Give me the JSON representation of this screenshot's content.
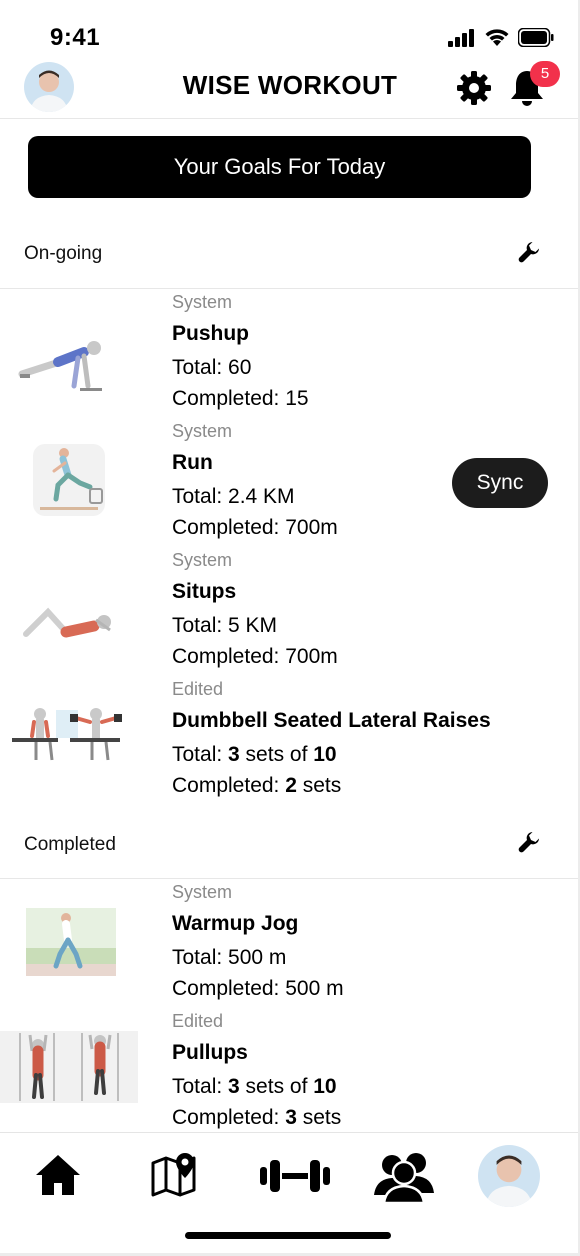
{
  "status_bar": {
    "time": "9:41"
  },
  "header": {
    "title": "WISE WORKOUT",
    "notification_count": "5"
  },
  "goals_button": {
    "label": "Your Goals For Today"
  },
  "sections": {
    "ongoing": {
      "label": "On-going"
    },
    "completed": {
      "label": "Completed"
    }
  },
  "ongoing_items": [
    {
      "source": "System",
      "name": "Pushup",
      "total": "Total: 60",
      "completed": "Completed: 15"
    },
    {
      "source": "System",
      "name": "Run",
      "total": "Total: 2.4 KM",
      "completed": "Completed: 700m",
      "action": "Sync"
    },
    {
      "source": "System",
      "name": "Situps",
      "total": "Total: 5 KM",
      "completed": "Completed: 700m"
    },
    {
      "source": "Edited",
      "name": "Dumbbell Seated Lateral Raises",
      "total_prefix": "Total: ",
      "total_sets": "3",
      "total_mid": " sets of ",
      "total_reps": "10",
      "completed_prefix": "Completed: ",
      "completed_sets": "2",
      "completed_suffix": " sets"
    }
  ],
  "completed_items": [
    {
      "source": "System",
      "name": "Warmup Jog",
      "total": "Total: 500 m",
      "completed": "Completed: 500 m"
    },
    {
      "source": "Edited",
      "name": "Pullups",
      "total_prefix": "Total: ",
      "total_sets": "3",
      "total_mid": " sets of ",
      "total_reps": "10",
      "completed_prefix": "Completed: ",
      "completed_sets": "3",
      "completed_suffix": " sets"
    }
  ],
  "bottom_nav": [
    "home-icon",
    "map-icon",
    "workout-icon",
    "community-icon",
    "profile-avatar"
  ],
  "colors": {
    "accent": "#000000",
    "badge": "#f2314b",
    "muted": "#8a8a8a"
  }
}
